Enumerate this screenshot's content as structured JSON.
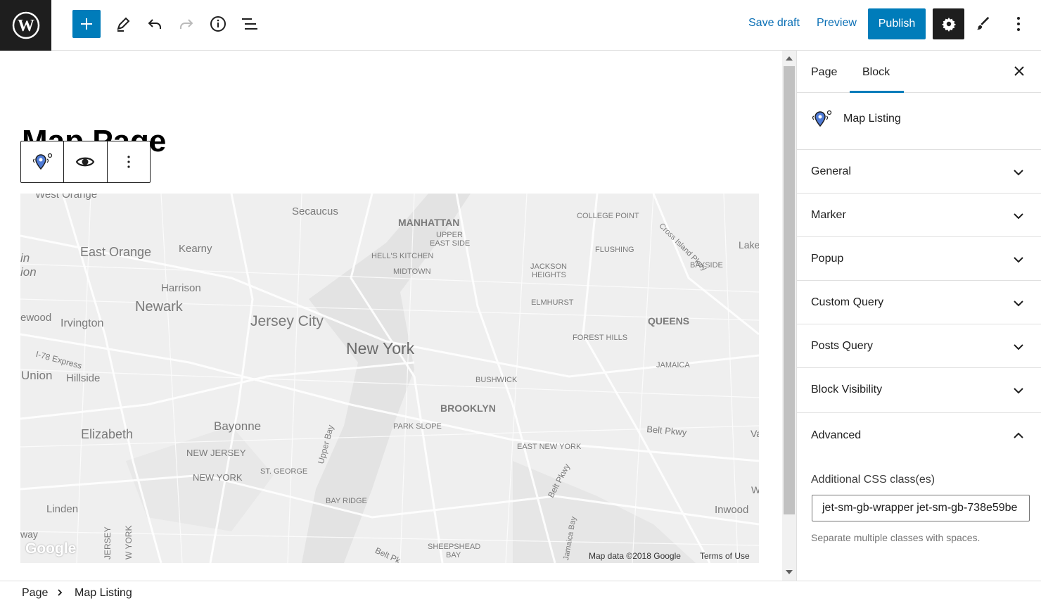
{
  "toolbar": {
    "save_draft": "Save draft",
    "preview": "Preview",
    "publish": "Publish"
  },
  "editor": {
    "page_title": "Map Page"
  },
  "map": {
    "labels": [
      {
        "text": "West Orange"
      },
      {
        "text": "Secaucus"
      },
      {
        "text": "MANHATTAN"
      },
      {
        "text": "UPPER"
      },
      {
        "text": "EAST SIDE"
      },
      {
        "text": "COLLEGE POINT"
      },
      {
        "text": "Cross Island Pkwy"
      },
      {
        "text": "Lake"
      },
      {
        "text": "East Orange"
      },
      {
        "text": "Kearny"
      },
      {
        "text": "HELL'S KITCHEN"
      },
      {
        "text": "MIDTOWN"
      },
      {
        "text": "FLUSHING"
      },
      {
        "text": "JACKSON"
      },
      {
        "text": "HEIGHTS"
      },
      {
        "text": "BAYSIDE"
      },
      {
        "text": "in"
      },
      {
        "text": "ion"
      },
      {
        "text": "Harrison"
      },
      {
        "text": "Newark"
      },
      {
        "text": "ELMHURST"
      },
      {
        "text": "ewood"
      },
      {
        "text": "Irvington"
      },
      {
        "text": "Jersey City"
      },
      {
        "text": "QUEENS"
      },
      {
        "text": "FOREST HILLS"
      },
      {
        "text": "New York"
      },
      {
        "text": "I-78 Express"
      },
      {
        "text": "JAMAICA"
      },
      {
        "text": "Union"
      },
      {
        "text": "Hillside"
      },
      {
        "text": "BUSHWICK"
      },
      {
        "text": "BROOKLYN"
      },
      {
        "text": "Elizabeth"
      },
      {
        "text": "Bayonne"
      },
      {
        "text": "Upper Bay"
      },
      {
        "text": "PARK SLOPE"
      },
      {
        "text": "Belt Pkwy"
      },
      {
        "text": "Va"
      },
      {
        "text": "NEW JERSEY"
      },
      {
        "text": "EAST NEW YORK"
      },
      {
        "text": "ST. GEORGE"
      },
      {
        "text": "NEW YORK"
      },
      {
        "text": "Belt Pkwy"
      },
      {
        "text": "W"
      },
      {
        "text": "Linden"
      },
      {
        "text": "BAY RIDGE"
      },
      {
        "text": "Inwood"
      },
      {
        "text": "way"
      },
      {
        "text": "JERSEY"
      },
      {
        "text": "W YORK"
      },
      {
        "text": "Jamaica Bay"
      },
      {
        "text": "Belt Pk"
      },
      {
        "text": "SHEEPSHEAD"
      },
      {
        "text": "BAY"
      }
    ],
    "google": "Google",
    "attribution": "Map data ©2018 Google",
    "terms": "Terms of Use"
  },
  "sidebar": {
    "tab_page": "Page",
    "tab_block": "Block",
    "block_name": "Map Listing",
    "panels": [
      "General",
      "Marker",
      "Popup",
      "Custom Query",
      "Posts Query",
      "Block Visibility"
    ],
    "advanced": {
      "title": "Advanced",
      "css_label": "Additional CSS class(es)",
      "css_value": "jet-sm-gb-wrapper jet-sm-gb-738e59be",
      "css_help": "Separate multiple classes with spaces."
    }
  },
  "footer": {
    "crumb_page": "Page",
    "crumb_block": "Map Listing"
  },
  "colors": {
    "accent": "#007cba",
    "dark": "#1e1e1e",
    "map_bg": "#efefef"
  }
}
